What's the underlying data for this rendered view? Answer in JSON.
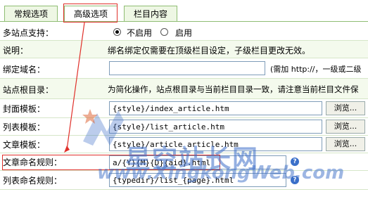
{
  "tabs": [
    {
      "label": "常规选项"
    },
    {
      "label": "高级选项"
    },
    {
      "label": "栏目内容"
    }
  ],
  "rows": {
    "multisite": {
      "label": "多站点支持：",
      "option_off": "不启用",
      "option_on": "启用"
    },
    "note": {
      "label": "说明：",
      "text": "绑名绑定仅需要在顶级栏目设定，子级栏目更改无效。"
    },
    "domain": {
      "label": "绑定域名：",
      "hint": "(需加 http://，一级或二级"
    },
    "siteroot": {
      "label": "站点根目录：",
      "text": "为简化操作，站点根目录与当前栏目目录一致，请注意当前栏目文件保"
    },
    "cover_tpl": {
      "label": "封面模板：",
      "value": "{style}/index_article.htm",
      "button": "浏览..."
    },
    "list_tpl": {
      "label": "列表模板：",
      "value": "{style}/list_article.htm",
      "button": "浏览..."
    },
    "article_tpl": {
      "label": "文章模板：",
      "value": "{style}/article_article.htm",
      "button": "浏览..."
    },
    "article_rule": {
      "label": "文章命名规则：",
      "value": "a/{Y}{M}{D}{aid}.html"
    },
    "list_rule": {
      "label": "列表命名规则：",
      "value": "{typedir}/list_{page}.html"
    }
  },
  "watermark": {
    "text_cn": "星空站长网",
    "text_url": "www.XingkongWeb.com"
  },
  "colors": {
    "accent_red": "#e0302a",
    "border_green": "#8fbd73",
    "row_bg": "#f4faed",
    "watermark_blue": "#3c6ec8"
  }
}
